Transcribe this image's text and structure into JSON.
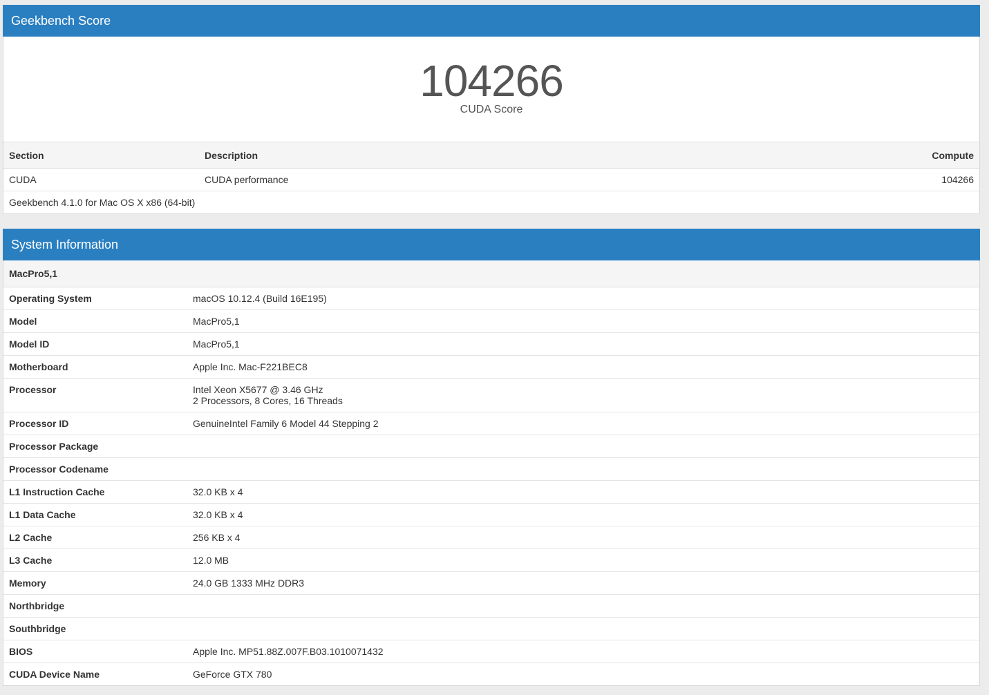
{
  "score_panel": {
    "header": "Geekbench Score",
    "score": "104266",
    "score_label": "CUDA Score",
    "columns": [
      "Section",
      "Description",
      "Compute"
    ],
    "rows": [
      {
        "section": "CUDA",
        "description": "CUDA performance",
        "compute": "104266"
      }
    ],
    "footer": "Geekbench 4.1.0 for Mac OS X x86 (64-bit)"
  },
  "system_panel": {
    "header": "System Information",
    "machine": "MacPro5,1",
    "rows": [
      {
        "key": "Operating System",
        "value": [
          "macOS 10.12.4 (Build 16E195)"
        ]
      },
      {
        "key": "Model",
        "value": [
          "MacPro5,1"
        ]
      },
      {
        "key": "Model ID",
        "value": [
          "MacPro5,1"
        ]
      },
      {
        "key": "Motherboard",
        "value": [
          "Apple Inc. Mac-F221BEC8"
        ]
      },
      {
        "key": "Processor",
        "value": [
          "Intel Xeon X5677 @ 3.46 GHz",
          "2 Processors, 8 Cores, 16 Threads"
        ]
      },
      {
        "key": "Processor ID",
        "value": [
          "GenuineIntel Family 6 Model 44 Stepping 2"
        ]
      },
      {
        "key": "Processor Package",
        "value": [
          ""
        ]
      },
      {
        "key": "Processor Codename",
        "value": [
          ""
        ]
      },
      {
        "key": "L1 Instruction Cache",
        "value": [
          "32.0 KB x 4"
        ]
      },
      {
        "key": "L1 Data Cache",
        "value": [
          "32.0 KB x 4"
        ]
      },
      {
        "key": "L2 Cache",
        "value": [
          "256 KB x 4"
        ]
      },
      {
        "key": "L3 Cache",
        "value": [
          "12.0 MB"
        ]
      },
      {
        "key": "Memory",
        "value": [
          "24.0 GB 1333 MHz DDR3"
        ]
      },
      {
        "key": "Northbridge",
        "value": [
          ""
        ]
      },
      {
        "key": "Southbridge",
        "value": [
          ""
        ]
      },
      {
        "key": "BIOS",
        "value": [
          "Apple Inc. MP51.88Z.007F.B03.1010071432"
        ]
      },
      {
        "key": "CUDA Device Name",
        "value": [
          "GeForce GTX 780"
        ]
      }
    ]
  },
  "colors": {
    "header_blue": "#2a7fc1",
    "background": "#ececec"
  }
}
